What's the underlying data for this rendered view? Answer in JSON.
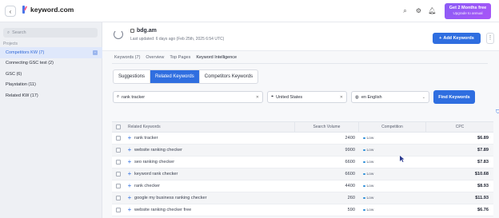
{
  "app": {
    "logo_text": "keyword.com"
  },
  "topbar": {
    "promo_line1": "Get 2 Months free",
    "promo_line2": "Upgrade to annual"
  },
  "sidebar": {
    "search_placeholder": "Search",
    "projects_heading": "Projects",
    "items": [
      {
        "label": "Competitors KW (7)",
        "active": true
      },
      {
        "label": "Connecting GSC test (2)"
      },
      {
        "label": "GSC (6)"
      },
      {
        "label": "Playstation (11)"
      },
      {
        "label": "Related KW (17)"
      }
    ]
  },
  "project": {
    "domain": "bdg.am",
    "updated": "Last updated: 6 days ago (Feb 25th, 2025 6:54 UTC)",
    "add_keywords_label": "Add Keywords"
  },
  "tabs": [
    "Keywords (7)",
    "Overview",
    "Top Pages",
    "Keyword Intelligence"
  ],
  "subtabs": [
    "Suggestions",
    "Related Keywords",
    "Competitors Keywords"
  ],
  "filters": {
    "keyword": "rank tracker",
    "location": "United States",
    "language": "en English",
    "find_label": "Find Keywords"
  },
  "table": {
    "headers": [
      "Related Keywords",
      "Search Volume",
      "Competition",
      "CPC"
    ],
    "rows": [
      {
        "keyword": "rank tracker",
        "volume": "2400",
        "competition": "Low",
        "cpc": "$6.89"
      },
      {
        "keyword": "website ranking checker",
        "volume": "9900",
        "competition": "Low",
        "cpc": "$7.89"
      },
      {
        "keyword": "seo ranking checker",
        "volume": "6600",
        "competition": "Low",
        "cpc": "$7.83"
      },
      {
        "keyword": "keyword rank checker",
        "volume": "6600",
        "competition": "Low",
        "cpc": "$10.68"
      },
      {
        "keyword": "rank checker",
        "volume": "4400",
        "competition": "Low",
        "cpc": "$8.93"
      },
      {
        "keyword": "google my business ranking checker",
        "volume": "260",
        "competition": "Low",
        "cpc": "$11.93"
      },
      {
        "keyword": "website ranking checker free",
        "volume": "590",
        "competition": "Low",
        "cpc": "$6.76"
      }
    ]
  },
  "colors": {
    "accent": "#2f6ee0",
    "promo": "#a855f7"
  }
}
